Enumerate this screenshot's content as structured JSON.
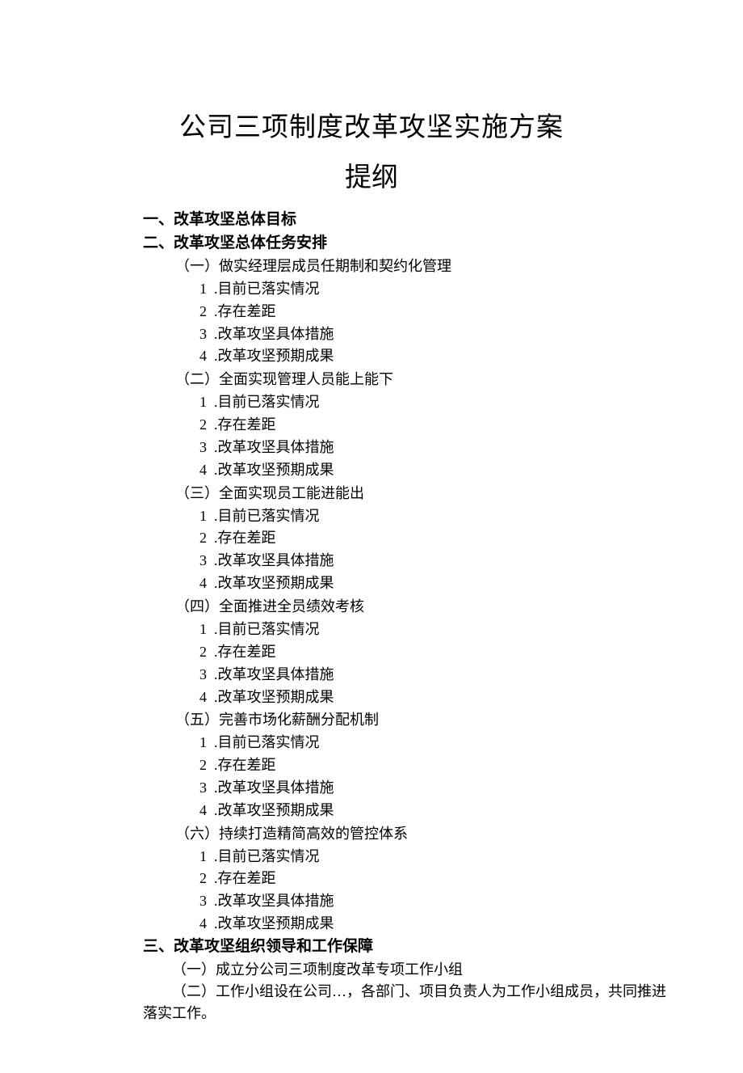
{
  "title": "公司三项制度改革攻坚实施方案",
  "subtitle": "提纲",
  "section1": "一、改革攻坚总体目标",
  "section2": "二、改革攻坚总体任务安排",
  "tasks": [
    {
      "label": "（一）做实经理层成员任期制和契约化管理",
      "items": [
        {
          "num": "1",
          "text": ".目前已落实情况"
        },
        {
          "num": "2",
          "text": ".存在差距"
        },
        {
          "num": "3",
          "text": ".改革攻坚具体措施"
        },
        {
          "num": "4",
          "text": ".改革攻坚预期成果"
        }
      ]
    },
    {
      "label": "（二）全面实现管理人员能上能下",
      "items": [
        {
          "num": "1",
          "text": ".目前已落实情况"
        },
        {
          "num": "2",
          "text": ".存在差距"
        },
        {
          "num": "3",
          "text": ".改革攻坚具体措施"
        },
        {
          "num": "4",
          "text": ".改革攻坚预期成果"
        }
      ]
    },
    {
      "label": "（三）全面实现员工能进能出",
      "items": [
        {
          "num": "1",
          "text": ".目前已落实情况"
        },
        {
          "num": "2",
          "text": ".存在差距"
        },
        {
          "num": "3",
          "text": ".改革攻坚具体措施"
        },
        {
          "num": "4",
          "text": ".改革攻坚预期成果"
        }
      ]
    },
    {
      "label": "（四）全面推进全员绩效考核",
      "items": [
        {
          "num": "1",
          "text": ".目前已落实情况"
        },
        {
          "num": "2",
          "text": ".存在差距"
        },
        {
          "num": "3",
          "text": ".改革攻坚具体措施"
        },
        {
          "num": "4",
          "text": ".改革攻坚预期成果"
        }
      ]
    },
    {
      "label": "（五）完善市场化薪酬分配机制",
      "items": [
        {
          "num": "1",
          "text": ".目前已落实情况"
        },
        {
          "num": "2",
          "text": ".存在差距"
        },
        {
          "num": "3",
          "text": ".改革攻坚具体措施"
        },
        {
          "num": "4",
          "text": ".改革攻坚预期成果"
        }
      ]
    },
    {
      "label": "（六）持续打造精简高效的管控体系",
      "items": [
        {
          "num": "1",
          "text": ".目前已落实情况"
        },
        {
          "num": "2",
          "text": ".存在差距"
        },
        {
          "num": "3",
          "text": ".改革攻坚具体措施"
        },
        {
          "num": "4",
          "text": ".改革攻坚预期成果"
        }
      ]
    }
  ],
  "section3": "三、改革攻坚组织领导和工作保障",
  "para1": "（一）成立分公司三项制度改革专项工作小组",
  "para2": "（二）工作小组设在公司…，各部门、项目负责人为工作小组成员，共同推进落实工作。"
}
